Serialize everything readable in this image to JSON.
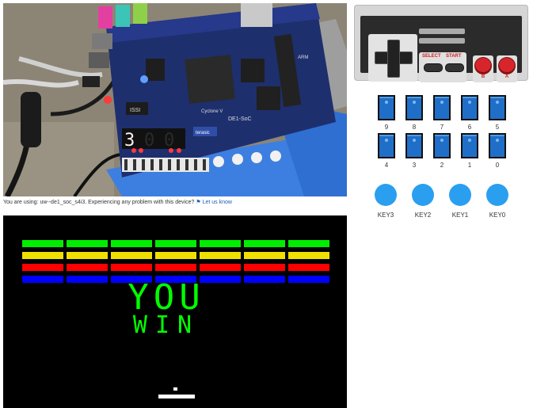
{
  "board": {
    "brand": "terasic",
    "model": "DE1-SoC",
    "chip": "Cyclone V",
    "issi": "ISSI",
    "arm": "ARM",
    "seg_digits": [
      "3",
      "0",
      "0"
    ]
  },
  "status": {
    "prefix": "You are using: uw--de1_soc_s4i3. Experiencing any problem with this device?",
    "link_text": "Let us know",
    "icon": "flag-icon"
  },
  "game": {
    "message_line1": "YOU",
    "message_line2": "WIN",
    "brick_colors": [
      "#00ee00",
      "#f0e000",
      "#ff0000",
      "#0000ff"
    ],
    "brick_columns": 7,
    "text_color": "#00ff00"
  },
  "controller": {
    "select_label": "SELECT",
    "start_label": "START",
    "b_label": "B",
    "a_label": "A"
  },
  "switches": {
    "row1": [
      "9",
      "8",
      "7",
      "6",
      "5"
    ],
    "row2": [
      "4",
      "3",
      "2",
      "1",
      "0"
    ]
  },
  "keys": [
    "KEY3",
    "KEY2",
    "KEY1",
    "KEY0"
  ],
  "colors": {
    "switch_blue": "#1f6fc9",
    "key_blue": "#2a9ff0",
    "nes_red": "#d7262b"
  }
}
